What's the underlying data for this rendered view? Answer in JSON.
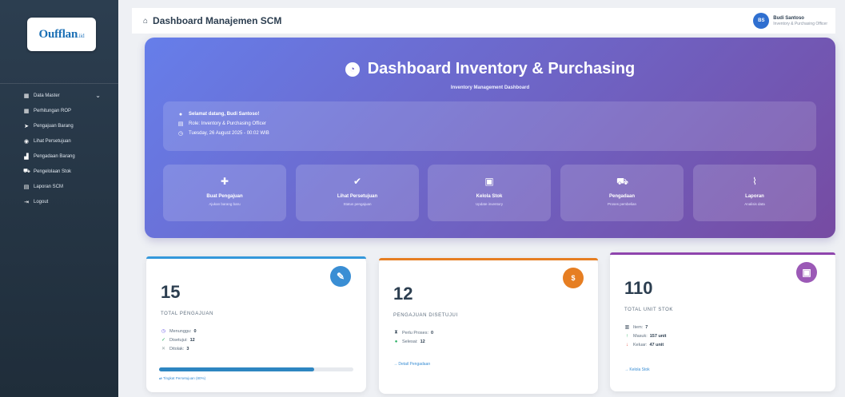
{
  "sidebar": {
    "logo_main": "Oufflan",
    "logo_small": ".iid",
    "items": [
      {
        "icon": "database-icon",
        "glyph": "▦",
        "label": "Data Master",
        "chevron": "⌄"
      },
      {
        "icon": "calculator-icon",
        "glyph": "▦",
        "label": "Perhitungan ROP"
      },
      {
        "icon": "send-icon",
        "glyph": "➤",
        "label": "Pengajuan Barang"
      },
      {
        "icon": "eye-icon",
        "glyph": "◉",
        "label": "Lihat Persetujuan"
      },
      {
        "icon": "chart-icon",
        "glyph": "▟",
        "label": "Pengadaan Barang"
      },
      {
        "icon": "truck-icon",
        "glyph": "⛟",
        "label": "Pengelolaan Stok"
      },
      {
        "icon": "file-icon",
        "glyph": "▤",
        "label": "Laporan SCM"
      },
      {
        "icon": "logout-icon",
        "glyph": "⇥",
        "label": "Logout"
      }
    ]
  },
  "topbar": {
    "title": "Dashboard Manajemen SCM",
    "user_initials": "BS",
    "user_name": "Budi Santoso",
    "user_role": "Inventory & Purchasing Officer"
  },
  "hero": {
    "title": "Dashboard Inventory & Purchasing",
    "subtitle": "Inventory Management Dashboard",
    "welcome": "Selamat datang, Budi Santoso!",
    "role": "Role: Inventory & Purchasing Officer",
    "date": "Tuesday, 26 August 2025 - 00:02 WIB"
  },
  "quick_actions": [
    {
      "icon": "plus-circle-icon",
      "glyph": "✚",
      "label": "Buat Pengajuan",
      "sub": "Ajukan barang baru"
    },
    {
      "icon": "check-circle-icon",
      "glyph": "✔",
      "label": "Lihat Persetujuan",
      "sub": "Status pengajuan"
    },
    {
      "icon": "warehouse-icon",
      "glyph": "▣",
      "label": "Kelola Stok",
      "sub": "Update inventory"
    },
    {
      "icon": "truck-icon",
      "glyph": "⛟",
      "label": "Pengadaan",
      "sub": "Proses pembelian"
    },
    {
      "icon": "chart-line-icon",
      "glyph": "⌇",
      "label": "Laporan",
      "sub": "Analisis data"
    }
  ],
  "cards": {
    "total_pengajuan": {
      "value": "15",
      "label": "TOTAL PENGAJUAN",
      "rows": [
        {
          "glyph": "◷",
          "label": "Menunggu:",
          "value": "0"
        },
        {
          "glyph": "✓",
          "label": "Disetujui:",
          "value": "12"
        },
        {
          "glyph": "✕",
          "label": "Ditolak:",
          "value": "3"
        }
      ],
      "progress": 0.8,
      "progress_label": "Tingkat Persetujuan (80%)"
    },
    "pengajuan_disetujui": {
      "value": "12",
      "label": "PENGAJUAN DISETUJUI",
      "rows": [
        {
          "glyph": "⧗",
          "label": "Perlu Proses:",
          "value": "0"
        },
        {
          "glyph": "●",
          "label": "Selesai:",
          "value": "12"
        }
      ],
      "link": "→ Detail Pengadaan"
    },
    "total_unit_stok": {
      "value": "110",
      "label": "TOTAL UNIT STOK",
      "rows": [
        {
          "glyph": "▥",
          "label": "Item:",
          "value": "7"
        },
        {
          "glyph": "↑",
          "label": "Masuk:",
          "value": "157 unit"
        },
        {
          "glyph": "↓",
          "label": "Keluar:",
          "value": "47 unit"
        }
      ],
      "link": "→ Kelola Stok"
    }
  },
  "colors": {
    "hero_start": "#667eea",
    "hero_end": "#764ba2",
    "sidebar": "#2c3e50",
    "accent_blue": "#3a8ed4",
    "accent_orange": "#e67e22",
    "accent_purple": "#9b59b6"
  }
}
